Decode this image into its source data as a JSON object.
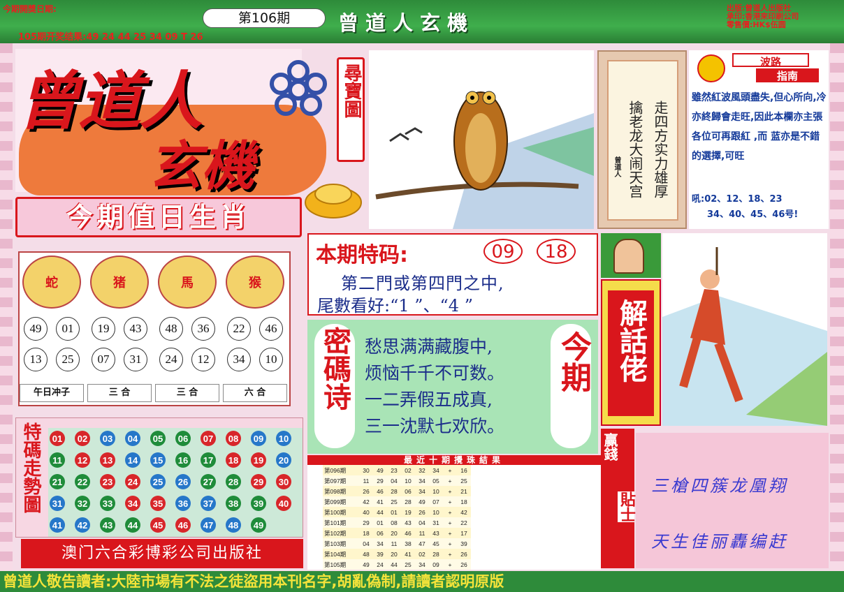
{
  "header": {
    "open_date_label": "今期開獎日期:",
    "issue": "第106期",
    "prev_result": "105期开奖结果:49 24 44 25 34 09 T 26",
    "title": "曾道人玄機",
    "publisher": [
      "出版:曾道人出版社",
      "承印:香港來印刷公司",
      "零售價:HK$伍圆"
    ]
  },
  "logo": {
    "line1": "曾道人",
    "line2": "玄機",
    "tag": "尋寶圖"
  },
  "poem_box": {
    "col1": "走四方实力雄厚",
    "col2": "擒老龙大闹天宫",
    "sig": "曾道人"
  },
  "guide": {
    "title1": "波路",
    "title2": "指南",
    "text": "雖然紅波風頭盡失,但心所向,冷亦終歸會走旺,因此本欄亦主張各位可再跟紅 ,而 蓝亦是不錯的選擇,可旺",
    "nums1": "吼:02、12、18、23",
    "nums2": "34、40、45、46号!"
  },
  "zodiac": {
    "title": "今期值日生肖",
    "animals": [
      {
        "name": "蛇",
        "numbers": [
          "49",
          "01",
          "13",
          "25"
        ],
        "rel": "午日冲子"
      },
      {
        "name": "猪",
        "numbers": [
          "19",
          "43",
          "07",
          "31"
        ],
        "rel": "三  合"
      },
      {
        "name": "馬",
        "numbers": [
          "48",
          "36",
          "24",
          "12"
        ],
        "rel": "三  合"
      },
      {
        "name": "猴",
        "numbers": [
          "22",
          "46",
          "34",
          "10"
        ],
        "rel": "六  合"
      }
    ]
  },
  "special": {
    "label": "本期特码:",
    "n1": "09",
    "n2": "18",
    "line2": "第二門或第四門之中,",
    "line3": "尾數看好:“1 ”、“4 ”"
  },
  "mima": {
    "left": "密碼诗",
    "right": "今期",
    "lines": [
      "愁思满满藏腹中,",
      "烦恼千千不可数。",
      "一二弄假五成真,",
      "三一沈默七欢欣。"
    ]
  },
  "jiehua": {
    "title": "解話佬"
  },
  "trend": {
    "label": "特碼走勢圖",
    "rows": [
      [
        [
          "01",
          "r"
        ],
        [
          "02",
          "r"
        ],
        [
          "03",
          "b"
        ],
        [
          "04",
          "b"
        ],
        [
          "05",
          "g"
        ],
        [
          "06",
          "g"
        ],
        [
          "07",
          "r"
        ],
        [
          "08",
          "r"
        ],
        [
          "09",
          "b"
        ],
        [
          "10",
          "b"
        ]
      ],
      [
        [
          "11",
          "g"
        ],
        [
          "12",
          "r"
        ],
        [
          "13",
          "r"
        ],
        [
          "14",
          "b"
        ],
        [
          "15",
          "b"
        ],
        [
          "16",
          "g"
        ],
        [
          "17",
          "g"
        ],
        [
          "18",
          "r"
        ],
        [
          "19",
          "r"
        ],
        [
          "20",
          "b"
        ]
      ],
      [
        [
          "21",
          "g"
        ],
        [
          "22",
          "g"
        ],
        [
          "23",
          "r"
        ],
        [
          "24",
          "r"
        ],
        [
          "25",
          "b"
        ],
        [
          "26",
          "b"
        ],
        [
          "27",
          "g"
        ],
        [
          "28",
          "g"
        ],
        [
          "29",
          "r"
        ],
        [
          "30",
          "r"
        ]
      ],
      [
        [
          "31",
          "b"
        ],
        [
          "32",
          "g"
        ],
        [
          "33",
          "g"
        ],
        [
          "34",
          "r"
        ],
        [
          "35",
          "r"
        ],
        [
          "36",
          "b"
        ],
        [
          "37",
          "b"
        ],
        [
          "38",
          "g"
        ],
        [
          "39",
          "g"
        ],
        [
          "40",
          "r"
        ]
      ],
      [
        [
          "41",
          "b"
        ],
        [
          "42",
          "b"
        ],
        [
          "43",
          "g"
        ],
        [
          "44",
          "g"
        ],
        [
          "45",
          "r"
        ],
        [
          "46",
          "r"
        ],
        [
          "47",
          "b"
        ],
        [
          "48",
          "b"
        ],
        [
          "49",
          "g"
        ]
      ]
    ],
    "footer": "澳门六合彩博彩公司出版社"
  },
  "history": {
    "title": "最近十期攪珠結果",
    "rows": [
      [
        "第096期",
        "30",
        "49",
        "23",
        "02",
        "32",
        "34",
        "+",
        "16"
      ],
      [
        "第097期",
        "11",
        "29",
        "04",
        "10",
        "34",
        "05",
        "+",
        "25"
      ],
      [
        "第098期",
        "26",
        "46",
        "28",
        "06",
        "34",
        "10",
        "+",
        "21"
      ],
      [
        "第099期",
        "42",
        "41",
        "25",
        "28",
        "49",
        "07",
        "+",
        "18"
      ],
      [
        "第100期",
        "40",
        "44",
        "01",
        "19",
        "26",
        "10",
        "+",
        "42"
      ],
      [
        "第101期",
        "29",
        "01",
        "08",
        "43",
        "04",
        "31",
        "+",
        "22"
      ],
      [
        "第102期",
        "18",
        "06",
        "20",
        "46",
        "11",
        "43",
        "+",
        "17"
      ],
      [
        "第103期",
        "04",
        "34",
        "11",
        "38",
        "47",
        "45",
        "+",
        "39"
      ],
      [
        "第104期",
        "48",
        "39",
        "20",
        "41",
        "02",
        "28",
        "+",
        "26"
      ],
      [
        "第105期",
        "49",
        "24",
        "44",
        "25",
        "34",
        "09",
        "+",
        "26"
      ]
    ]
  },
  "tips": {
    "l1": "赢",
    "l2": "錢",
    "l3": "貼",
    "l4": "士",
    "line1": "三槍四簇龙凰翔",
    "line2": "天生佳丽轟编赶"
  },
  "bottom": "曾道人敬告讀者:大陸市場有不法之徒盜用本刊名字,胡亂偽制,請讀者認明原版",
  "colors": {
    "red": "#d8262a",
    "green": "#2e8b3a",
    "pink": "#f5c6d8"
  }
}
